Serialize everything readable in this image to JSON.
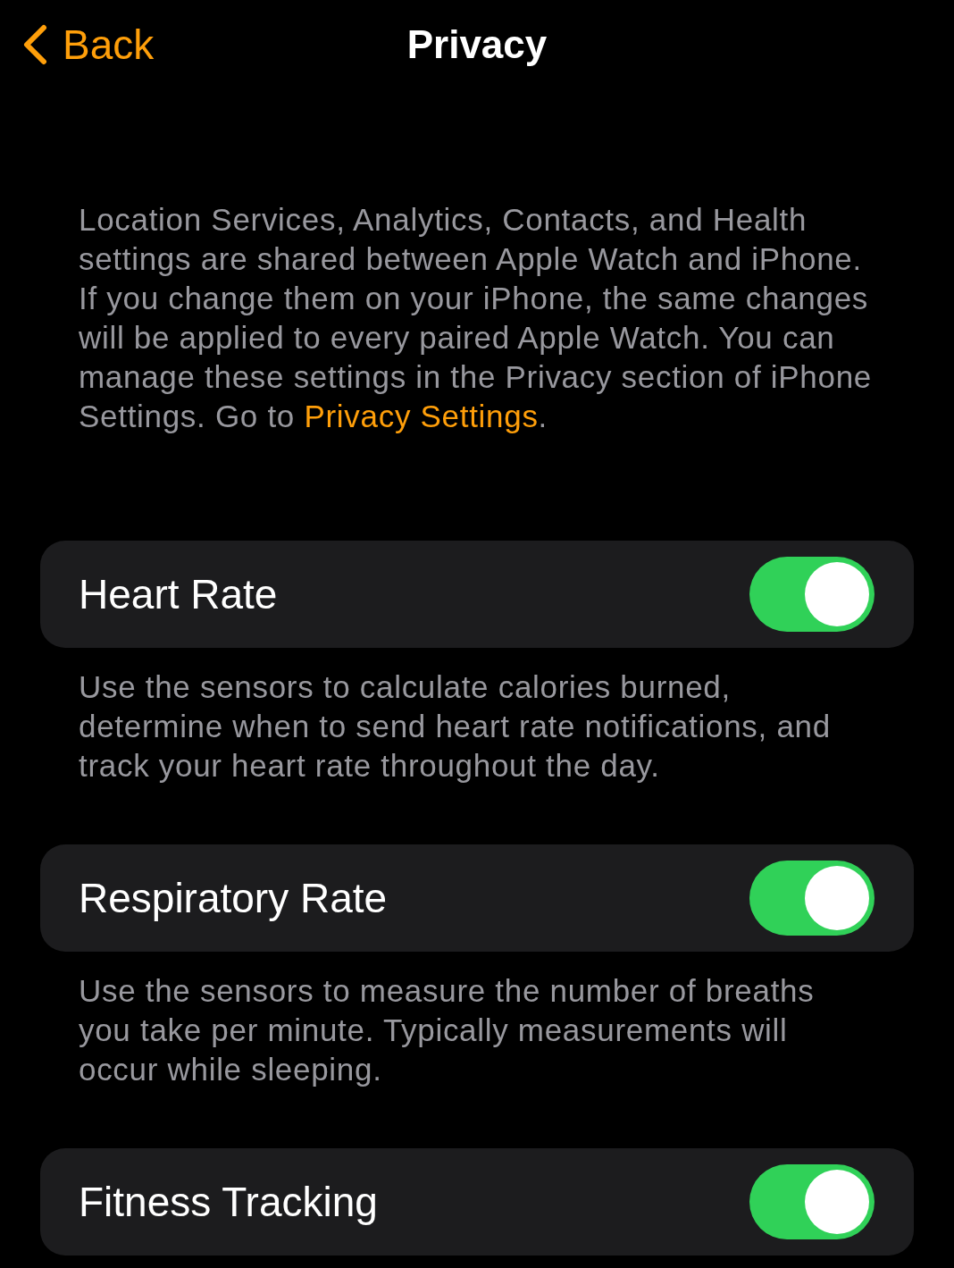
{
  "nav": {
    "back": "Back",
    "title": "Privacy"
  },
  "intro": {
    "text": "Location Services, Analytics, Contacts, and Health settings are shared between Apple Watch and iPhone. If you change them on your iPhone, the same changes will be applied to every paired Apple Watch. You can manage these settings in the Privacy section of iPhone Settings. Go to ",
    "link": "Privacy Settings",
    "after": "."
  },
  "settings": [
    {
      "label": "Heart Rate",
      "on": true,
      "footer": "Use the sensors to calculate calories burned, determine when to send heart rate notifications, and track your heart rate throughout the day."
    },
    {
      "label": "Respiratory Rate",
      "on": true,
      "footer": "Use the sensors to measure the number of breaths you take per minute. Typically measurements will occur while sleeping."
    },
    {
      "label": "Fitness Tracking",
      "on": true
    }
  ]
}
